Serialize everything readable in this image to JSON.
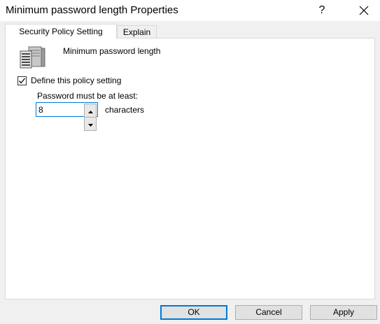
{
  "window": {
    "title": "Minimum password length Properties",
    "help_label": "?"
  },
  "tabs": [
    {
      "label": "Security Policy Setting",
      "active": true
    },
    {
      "label": "Explain",
      "active": false
    }
  ],
  "policy": {
    "icon": "server-policy-icon",
    "name": "Minimum password length",
    "define_label": "Define this policy setting",
    "define_checked": true,
    "min_label": "Password must be at least:",
    "value": "8",
    "unit_label": "characters"
  },
  "buttons": {
    "ok": "OK",
    "cancel": "Cancel",
    "apply": "Apply"
  },
  "colors": {
    "accent": "#0078d7",
    "dialog_bg": "#f0f0f0",
    "panel_bg": "#ffffff",
    "button_bg": "#e1e1e1"
  }
}
